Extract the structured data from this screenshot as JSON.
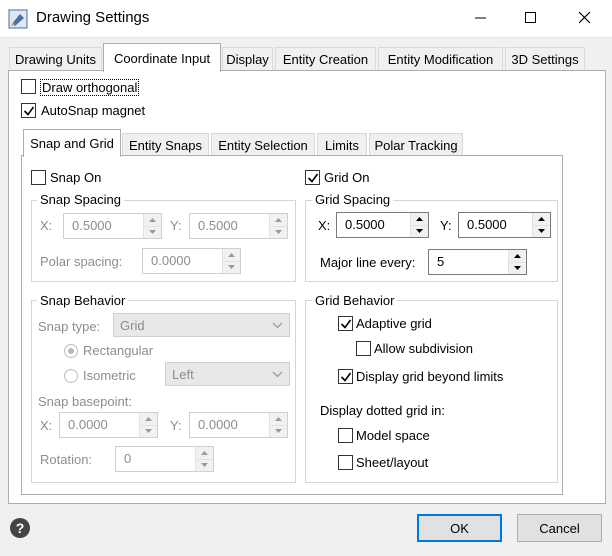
{
  "window": {
    "title": "Drawing Settings"
  },
  "main_tabs": [
    "Drawing Units",
    "Coordinate Input",
    "Display",
    "Entity Creation",
    "Entity Modification",
    "3D Settings"
  ],
  "options": {
    "draw_orthogonal": {
      "label": "Draw orthogonal",
      "checked": false
    },
    "autosnap_magnet": {
      "label": "AutoSnap magnet",
      "checked": true
    }
  },
  "sub_tabs": [
    "Snap and Grid",
    "Entity Snaps",
    "Entity Selection",
    "Limits",
    "Polar Tracking"
  ],
  "snap": {
    "snap_on": {
      "label": "Snap On",
      "checked": false
    },
    "spacing_title": "Snap Spacing",
    "x_label": "X:",
    "x_value": "0.5000",
    "y_label": "Y:",
    "y_value": "0.5000",
    "polar_label": "Polar spacing:",
    "polar_value": "0.0000",
    "behavior_title": "Snap Behavior",
    "type_label": "Snap type:",
    "type_value": "Grid",
    "rect_label": "Rectangular",
    "iso_label": "Isometric",
    "iso_value": "Left",
    "basepoint_label": "Snap basepoint:",
    "bx_label": "X:",
    "bx_value": "0.0000",
    "by_label": "Y:",
    "by_value": "0.0000",
    "rotation_label": "Rotation:",
    "rotation_value": "0"
  },
  "grid": {
    "grid_on": {
      "label": "Grid On",
      "checked": true
    },
    "spacing_title": "Grid Spacing",
    "x_label": "X:",
    "x_value": "0.5000",
    "y_label": "Y:",
    "y_value": "0.5000",
    "major_label": "Major line every:",
    "major_value": "5",
    "behavior_title": "Grid Behavior",
    "adaptive": {
      "label": "Adaptive grid",
      "checked": true
    },
    "subdivision": {
      "label": "Allow subdivision",
      "checked": false
    },
    "beyond": {
      "label": "Display grid beyond limits",
      "checked": true
    },
    "dotted_label": "Display dotted grid in:",
    "model": {
      "label": "Model space",
      "checked": false
    },
    "sheet": {
      "label": "Sheet/layout",
      "checked": false
    }
  },
  "buttons": {
    "ok": "OK",
    "cancel": "Cancel"
  },
  "colors": {
    "accent": "#0078d7",
    "panel_bg": "#ffffff",
    "window_bg": "#f0f0f0"
  }
}
